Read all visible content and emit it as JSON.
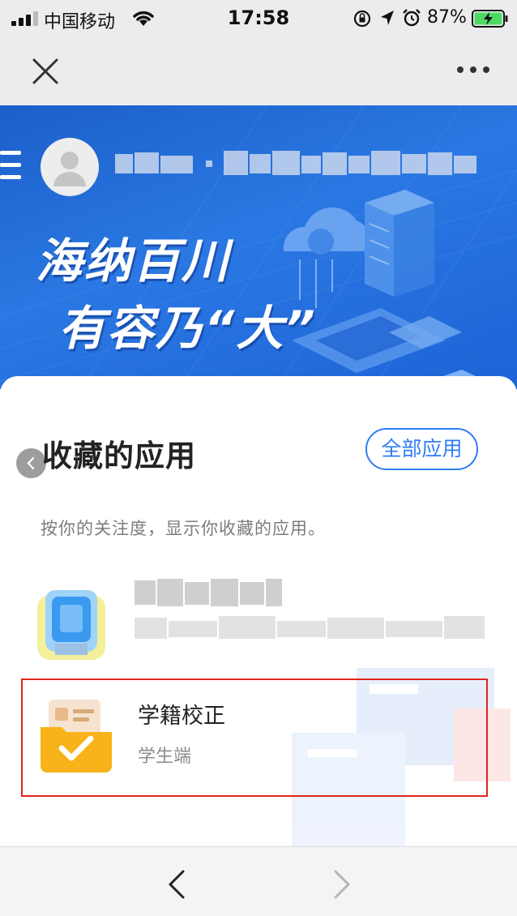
{
  "status_bar": {
    "carrier": "中国移动",
    "time": "17:58",
    "battery_percent": "87%",
    "icons": [
      "signal-icon",
      "wifi-icon",
      "rotation-lock-icon",
      "location-icon",
      "alarm-icon",
      "battery-charging-icon"
    ]
  },
  "nav_bar": {
    "icons": [
      "close-icon",
      "more-icon"
    ]
  },
  "banner": {
    "slogan_line1": "海纳百川",
    "slogan_line2": "有容乃“大”",
    "colors": {
      "primary": "#2a78e3"
    }
  },
  "favorites": {
    "title": "收藏的应用",
    "all_apps_label": "全部应用",
    "description": "按你的关注度，显示你收藏的应用。",
    "apps": [
      {
        "name": "学籍校正",
        "subtitle": "学生端"
      }
    ],
    "colors": {
      "accent": "#2f7cf6",
      "highlight": "#e0261e"
    }
  },
  "bottom_bar": {
    "icons": [
      "back-arrow-icon",
      "forward-arrow-icon"
    ]
  }
}
